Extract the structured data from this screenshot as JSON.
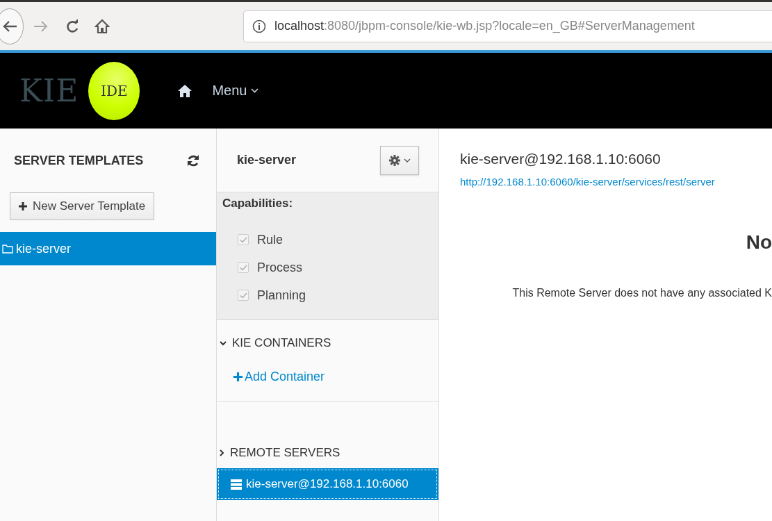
{
  "browser": {
    "url_host": "localhost",
    "url_rest": ":8080/jbpm-console/kie-wb.jsp?locale=en_GB#ServerManagement"
  },
  "header": {
    "logo_text": "KIE",
    "logo_badge": "IDE",
    "menu": "Menu"
  },
  "server_templates": {
    "title": "SERVER TEMPLATES",
    "new_button": "New Server Template",
    "items": [
      {
        "label": "kie-server",
        "selected": true
      }
    ]
  },
  "template": {
    "title": "kie-server",
    "capabilities_label": "Capabilities:",
    "capabilities": [
      {
        "label": "Rule",
        "checked": true
      },
      {
        "label": "Process",
        "checked": true
      },
      {
        "label": "Planning",
        "checked": true
      }
    ],
    "containers": {
      "title": "KIE CONTAINERS",
      "expanded": true,
      "add_link": "Add Container"
    },
    "remote_servers": {
      "title": "REMOTE SERVERS",
      "expanded": false,
      "items": [
        {
          "label": "kie-server@192.168.1.10:6060",
          "selected": true
        }
      ]
    }
  },
  "server": {
    "title": "kie-server@192.168.1.10:6060",
    "url": "http://192.168.1.10:6060/kie-server/services/rest/server",
    "empty_heading": "No",
    "empty_message": "This Remote Server does not have any associated K"
  }
}
